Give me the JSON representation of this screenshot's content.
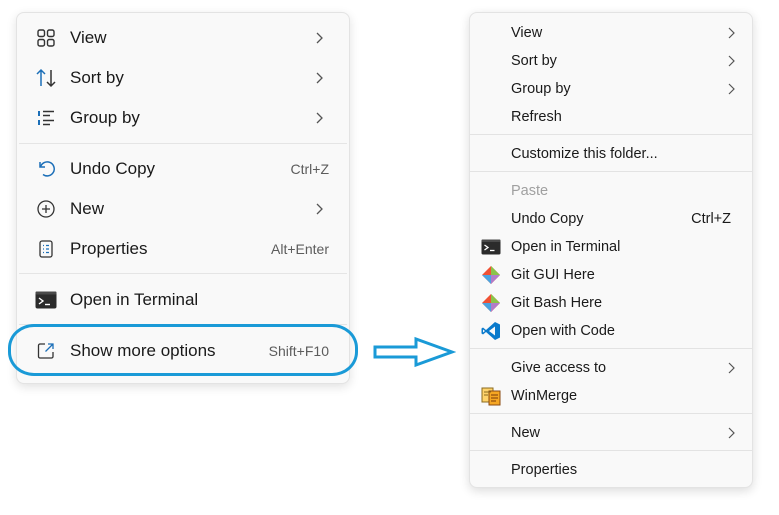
{
  "new_menu": {
    "items": [
      {
        "label": "View",
        "icon": "view-grid-icon",
        "submenu": true
      },
      {
        "label": "Sort by",
        "icon": "sort-arrows-icon",
        "submenu": true
      },
      {
        "label": "Group by",
        "icon": "group-list-icon",
        "submenu": true
      },
      {
        "label": "Undo Copy",
        "icon": "undo-icon",
        "shortcut": "Ctrl+Z"
      },
      {
        "label": "New",
        "icon": "new-plus-icon",
        "submenu": true
      },
      {
        "label": "Properties",
        "icon": "properties-icon",
        "shortcut": "Alt+Enter"
      },
      {
        "label": "Open in Terminal",
        "icon": "terminal-icon"
      },
      {
        "label": "Show more options",
        "icon": "show-more-icon",
        "shortcut": "Shift+F10"
      }
    ]
  },
  "classic_menu": {
    "items": [
      {
        "label": "View",
        "submenu": true
      },
      {
        "label": "Sort by",
        "submenu": true
      },
      {
        "label": "Group by",
        "submenu": true
      },
      {
        "label": "Refresh"
      },
      {
        "label": "Customize this folder..."
      },
      {
        "label": "Paste",
        "disabled": true
      },
      {
        "label": "Undo Copy",
        "shortcut": "Ctrl+Z"
      },
      {
        "label": "Open in Terminal",
        "icon": "terminal-icon"
      },
      {
        "label": "Git GUI Here",
        "icon": "git-icon"
      },
      {
        "label": "Git Bash Here",
        "icon": "git-icon"
      },
      {
        "label": "Open with Code",
        "icon": "vscode-icon"
      },
      {
        "label": "Give access to",
        "submenu": true
      },
      {
        "label": "WinMerge",
        "icon": "winmerge-icon"
      },
      {
        "label": "New",
        "submenu": true
      },
      {
        "label": "Properties"
      }
    ]
  },
  "colors": {
    "highlight_outline": "#1a9ad7",
    "arrow": "#1a9ad7",
    "menu_background": "#f9f9f9",
    "vscode_blue": "#0a7acc"
  }
}
